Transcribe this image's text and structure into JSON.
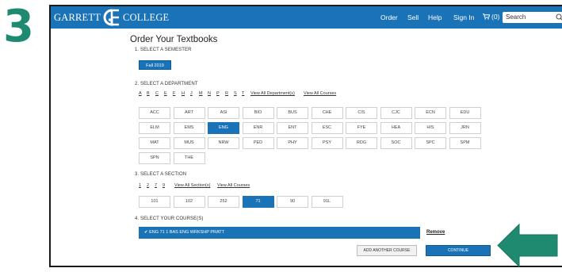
{
  "step_number": "3",
  "navbar": {
    "logo_left": "GARRETT",
    "logo_right": "COLLEGE",
    "links": [
      "Order",
      "Sell",
      "Help",
      "Sign In"
    ],
    "cart_label": "(0)",
    "search_placeholder": "Search"
  },
  "page_title": "Order Your Textbooks",
  "semester": {
    "label": "1. SELECT A SEMESTER",
    "selected": "Fall 2019"
  },
  "department": {
    "label": "2. SELECT A DEPARTMENT",
    "letters": [
      "A",
      "B",
      "C",
      "E",
      "F",
      "H",
      "J",
      "M",
      "N",
      "P",
      "R",
      "S",
      "T"
    ],
    "view_all_departments": "View All Department(s)",
    "view_all_courses": "View All Courses",
    "items": [
      "ACC",
      "ART",
      "ASI",
      "BIO",
      "BUS",
      "CHE",
      "CIS",
      "CJC",
      "ECN",
      "EDU",
      "ELM",
      "EMS",
      "ENG",
      "ENR",
      "ENT",
      "ESC",
      "FYE",
      "HEA",
      "HIS",
      "JRN",
      "MAT",
      "MUS",
      "NRW",
      "PED",
      "PHY",
      "PSY",
      "RDG",
      "SOC",
      "SPC",
      "SPM",
      "SPN",
      "THE"
    ],
    "selected": "ENG"
  },
  "section": {
    "label": "3. SELECT A SECTION",
    "links": [
      "1",
      "2",
      "7",
      "9"
    ],
    "view_all_sections": "View All Section(s)",
    "view_all_courses": "View All Courses",
    "items": [
      "101",
      "102",
      "252",
      "71",
      "90",
      "91L"
    ],
    "selected": "71"
  },
  "courses": {
    "label": "4. SELECT YOUR COURSE(S)",
    "selected_course": "✔ ENG 71 1  BAS ENG WRKSHP PRATT",
    "remove_label": "Remove"
  },
  "buttons": {
    "add_another": "ADD ANOTHER COURSE",
    "continue": "CONTINUE"
  },
  "colors": {
    "brand_blue": "#1b73b7",
    "annotation_green": "#1f8a70"
  }
}
